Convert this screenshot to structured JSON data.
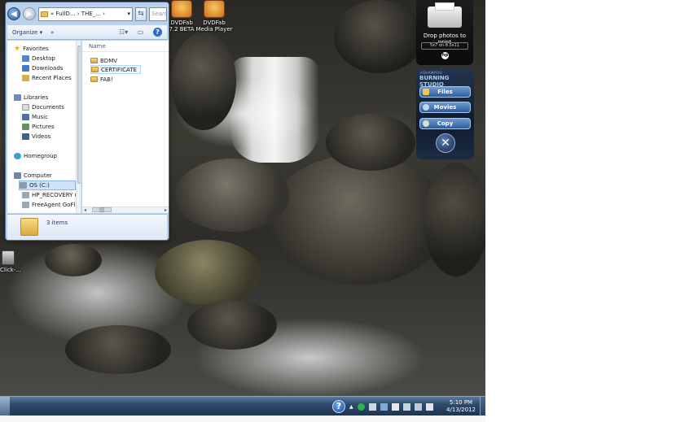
{
  "explorer": {
    "address_text": "« FullD... › THE_... ›",
    "search_placeholder": "Search",
    "toolbar": {
      "organize_label": "Organize ▾",
      "more_label": "»"
    },
    "nav": {
      "favorites": "Favorites",
      "desktop": "Desktop",
      "downloads": "Downloads",
      "recent_places": "Recent Places",
      "libraries": "Libraries",
      "documents": "Documents",
      "music": "Music",
      "pictures": "Pictures",
      "videos": "Videos",
      "homegroup": "Homegroup",
      "computer": "Computer",
      "os_c": "OS (C:)",
      "hp_recovery": "HP_RECOVERY (I",
      "freeagent": "FreeAgent GoFle"
    },
    "column_name": "Name",
    "files": [
      "BDMV",
      "CERTIFICATE",
      "FAB!"
    ],
    "hscroll_grip": "|||",
    "item_count": "3 items"
  },
  "desktop_icons": {
    "dvdfab_beta": {
      "line1": "DVDFab",
      "line2": "7.2 BETA"
    },
    "dvdfab_player": {
      "line1": "DVDFab",
      "line2": "Media Player"
    },
    "click_label": "Click-..."
  },
  "hp_gadget": {
    "title": "Drop photos to print",
    "paper_size": "5x7 on 8.5x11",
    "logo": "hp"
  },
  "burning_studio": {
    "brand_small": "ASHAMPOO",
    "brand": "BURNING STUDIO",
    "buttons": [
      "Files",
      "Movies",
      "Copy"
    ],
    "close_symbol": "✕"
  },
  "taskbar": {
    "time": "5:10 PM",
    "date": "4/13/2012",
    "tray_up_arrow": "▲"
  },
  "colors": {
    "taskbar": "#2f4a6c",
    "explorer_frame": "#b9d1ea",
    "gadget_accent": "#6d9bd1"
  }
}
